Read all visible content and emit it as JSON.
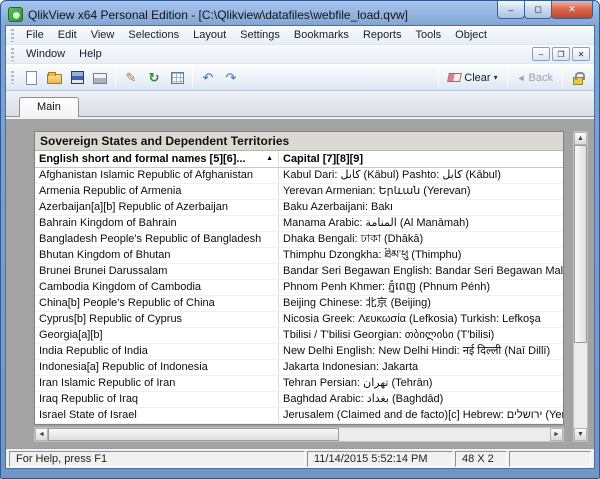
{
  "colors": {
    "frame_blue": "#7fa3d4",
    "qlik_green": "#2e8f35",
    "close_red": "#bf4630",
    "content_gray": "#a3a3a3",
    "caption_bg": "#dadad2"
  },
  "window": {
    "title": "QlikView x64 Personal Edition - [C:\\Qlikview\\datafiles\\webfile_load.qvw]",
    "controls": {
      "minimize": "–",
      "maximize": "◻",
      "close": "✕"
    }
  },
  "menu": {
    "row1": [
      "File",
      "Edit",
      "View",
      "Selections",
      "Layout",
      "Settings",
      "Bookmarks",
      "Reports",
      "Tools",
      "Object"
    ],
    "row2": [
      "Window",
      "Help"
    ],
    "mdi_controls": {
      "minimize": "–",
      "restore": "❐",
      "close": "✕"
    }
  },
  "toolbar": {
    "icons": [
      "new-file",
      "open-folder",
      "save",
      "print",
      "edit-script",
      "reload",
      "table-viewer",
      "undo",
      "redo"
    ],
    "clear": {
      "label": "Clear",
      "dropdown": "▾"
    },
    "back": {
      "label": "Back",
      "arrow": "◄",
      "disabled": true
    }
  },
  "tabs": {
    "active": "Main"
  },
  "sheet": {
    "table": {
      "caption": "Sovereign States and Dependent Territories",
      "columns": [
        {
          "label": "English short and formal names [5][6]...",
          "sort_indicator": "▲"
        },
        {
          "label": "Capital [7][8][9]"
        }
      ],
      "rows": [
        [
          "Afghanistan Islamic Republic of Afghanistan",
          "Kabul Dari: كابل (Kābul) Pashto: كابل (Kābul)"
        ],
        [
          "Armenia Republic of Armenia",
          "Yerevan Armenian: Երևան (Yerevan)"
        ],
        [
          "Azerbaijan[a][b] Republic of Azerbaijan",
          "Baku Azerbaijani: Bakı"
        ],
        [
          "Bahrain Kingdom of Bahrain",
          "Manama Arabic: المنامة (Al Manāmah)"
        ],
        [
          "Bangladesh People's Republic of Bangladesh",
          "Dhaka Bengali: ঢাকা (Dhākā)"
        ],
        [
          "Bhutan Kingdom of Bhutan",
          "Thimphu  Dzongkha: ཐིམ་ཕུ (Thimphu)"
        ],
        [
          "Brunei Brunei Darussalam",
          "Bandar Seri Begawan English: Bandar Seri Begawan Malay: B"
        ],
        [
          "Cambodia Kingdom of Cambodia",
          "Phnom Penh Khmer: ភ្នំពេញ (Phnum Pénh)"
        ],
        [
          "China[b] People's Republic of China",
          "Beijing  Chinese: 北京 (Beijing)"
        ],
        [
          "Cyprus[b] Republic of Cyprus",
          "Nicosia Greek: Λευκωσία (Lefkosia) Turkish: Lefkoşa"
        ],
        [
          "Georgia[a][b]",
          "Tbilisi / T'bilisi Georgian: თბილისი (T'bilisi)"
        ],
        [
          "India Republic of India",
          "New Delhi English: New Delhi Hindi: नई दिल्ली (Naī Dillī)"
        ],
        [
          "Indonesia[a] Republic of Indonesia",
          "Jakarta Indonesian: Jakarta"
        ],
        [
          "Iran Islamic Republic of Iran",
          "Tehran Persian: تهران (Tehrān)"
        ],
        [
          "Iraq Republic of Iraq",
          "Baghdad Arabic: بغداد (Baghdād)"
        ],
        [
          "Israel State of Israel",
          "Jerusalem (Claimed and de facto)[c] Hebrew: ירושלים (Yeru"
        ]
      ]
    }
  },
  "scrollbar": {
    "up": "▲",
    "down": "▼",
    "left": "◄",
    "right": "►"
  },
  "statusbar": {
    "help_text": "For Help, press F1",
    "timestamp": "11/14/2015 5:52:14 PM",
    "size": "48 X 2"
  }
}
